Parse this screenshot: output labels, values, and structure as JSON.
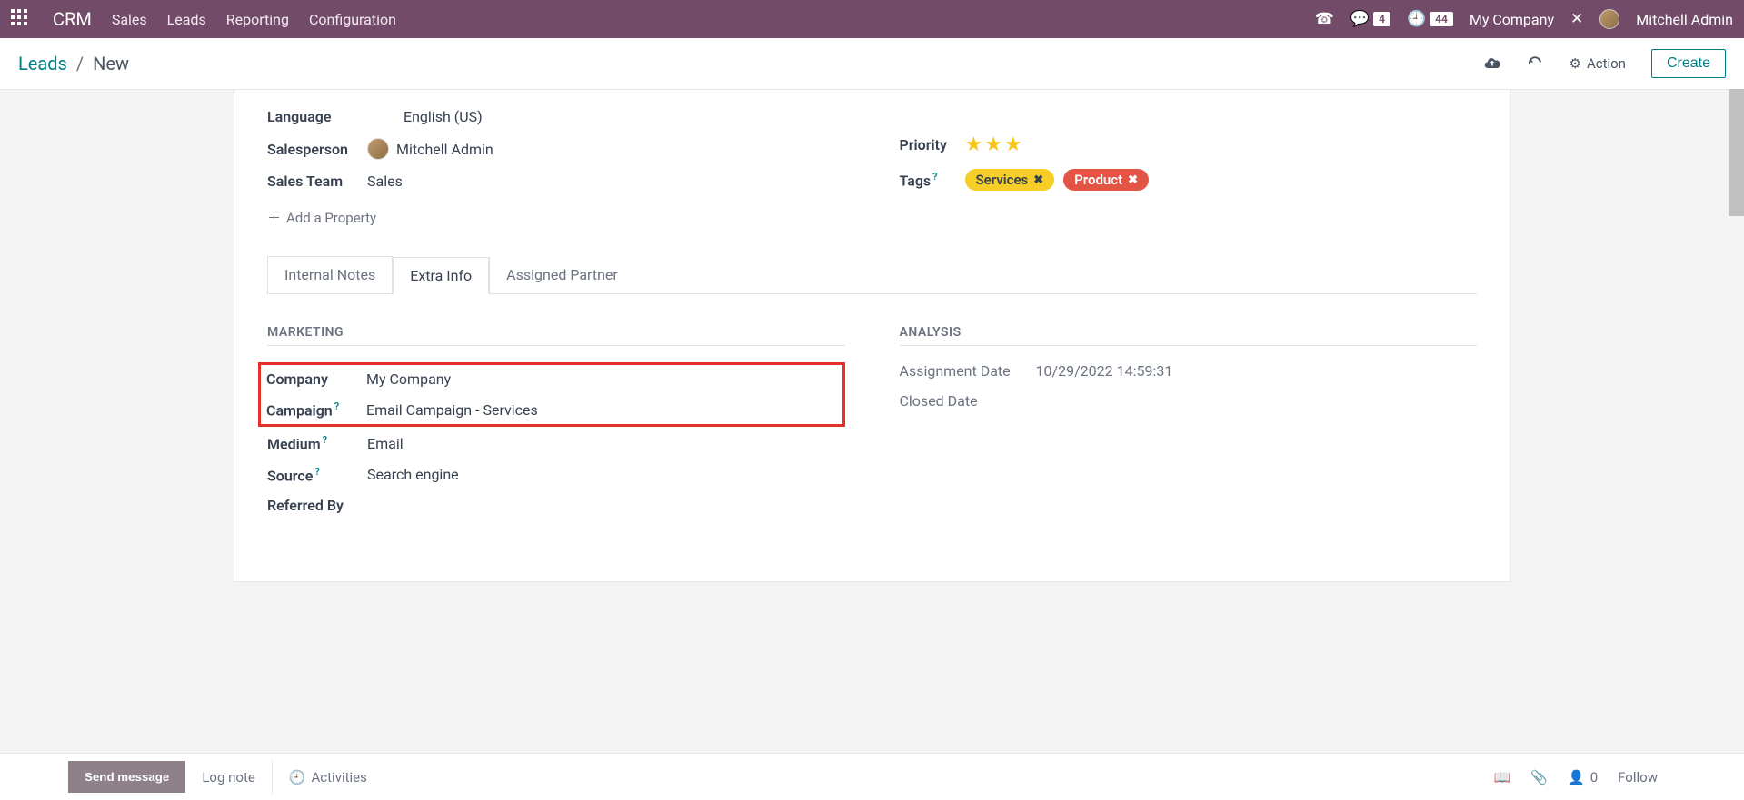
{
  "navbar": {
    "app_title": "CRM",
    "links": [
      "Sales",
      "Leads",
      "Reporting",
      "Configuration"
    ],
    "chat_count": "4",
    "clock_count": "44",
    "company": "My Company",
    "user": "Mitchell Admin"
  },
  "breadcrumb": {
    "root": "Leads",
    "current": "New"
  },
  "actions": {
    "action_label": "Action",
    "create_label": "Create"
  },
  "form": {
    "language_label": "Language",
    "language_value": "English (US)",
    "salesperson_label": "Salesperson",
    "salesperson_value": "Mitchell Admin",
    "salesteam_label": "Sales Team",
    "salesteam_value": "Sales",
    "add_property_label": "Add a Property",
    "priority_label": "Priority",
    "tags_label": "Tags",
    "tags": [
      {
        "label": "Services",
        "color": "yellow"
      },
      {
        "label": "Product",
        "color": "red"
      }
    ]
  },
  "tabs": {
    "notes": "Internal Notes",
    "extra": "Extra Info",
    "partner": "Assigned Partner"
  },
  "marketing": {
    "heading": "MARKETING",
    "company_label": "Company",
    "company_value": "My Company",
    "campaign_label": "Campaign",
    "campaign_value": "Email Campaign - Services",
    "medium_label": "Medium",
    "medium_value": "Email",
    "source_label": "Source",
    "source_value": "Search engine",
    "referred_label": "Referred By",
    "referred_value": ""
  },
  "analysis": {
    "heading": "ANALYSIS",
    "assignment_label": "Assignment Date",
    "assignment_value": "10/29/2022 14:59:31",
    "closed_label": "Closed Date",
    "closed_value": ""
  },
  "chatter": {
    "send": "Send message",
    "log": "Log note",
    "activities": "Activities",
    "follower_count": "0",
    "follow": "Follow"
  }
}
